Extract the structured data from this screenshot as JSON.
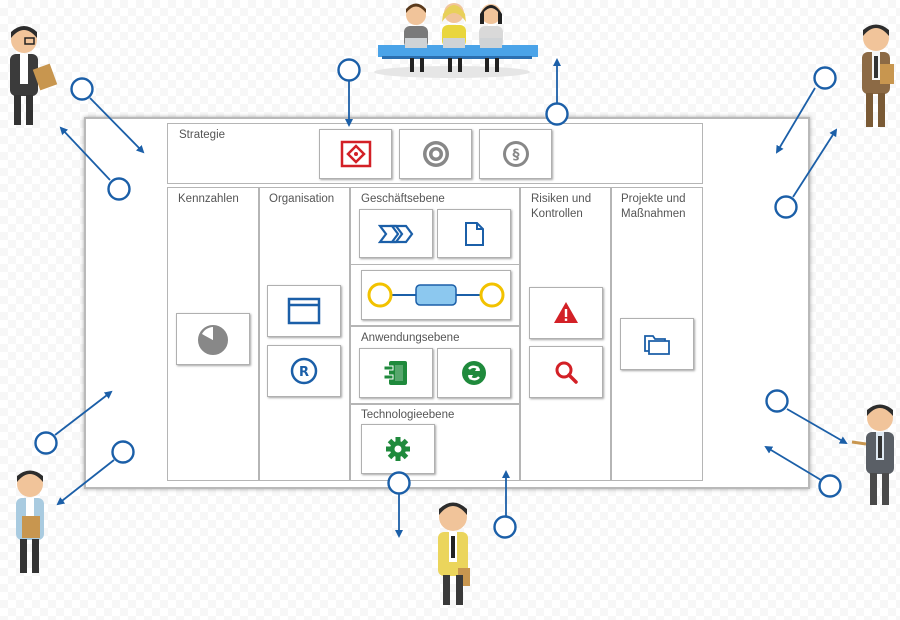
{
  "diagram": {
    "layers": {
      "strategie": "Strategie",
      "kennzahlen": "Kennzahlen",
      "organisation": "Organisation",
      "geschaeftsebene": "Geschäftsebene",
      "risiken": "Risiken und Kontrollen",
      "projekte": "Projekte und Maßnahmen",
      "anwendungsebene": "Anwendungsebene",
      "technologieebene": "Technologieebene"
    },
    "icons": {
      "strategie": [
        "diamond-target-icon",
        "bullseye-icon",
        "paragraph-icon"
      ],
      "kennzahlen": [
        "pie-chart-icon"
      ],
      "organisation": [
        "window-icon",
        "registered-icon"
      ],
      "geschaeftsebene": [
        "process-chevron-icon",
        "document-icon",
        "process-flow-icon"
      ],
      "anwendungsebene": [
        "component-icon",
        "refresh-icon"
      ],
      "technologieebene": [
        "gear-icon"
      ],
      "risiken": [
        "warning-icon",
        "search-icon"
      ],
      "projekte": [
        "folder-icon"
      ]
    },
    "colors": {
      "accent_blue": "#1b5fa8",
      "risk_red": "#d32026",
      "app_green": "#1f8a3c",
      "flow_yellow": "#f2c200",
      "flow_lightblue": "#8cc8ef"
    }
  }
}
